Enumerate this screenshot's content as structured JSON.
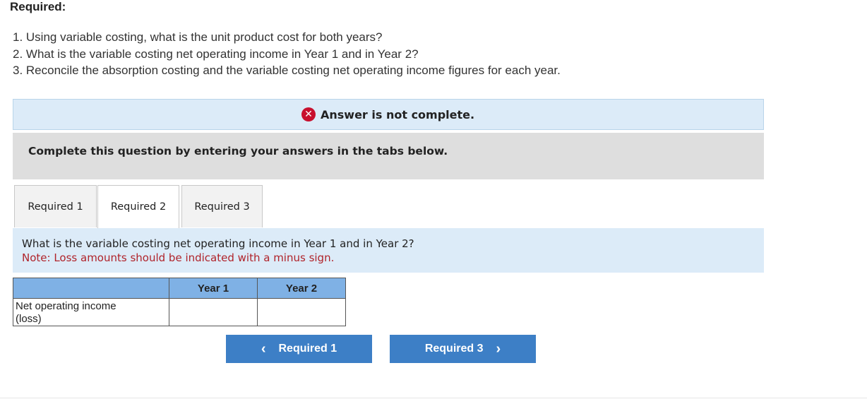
{
  "heading": "Required:",
  "questions": [
    "1. Using variable costing, what is the unit product cost for both years?",
    "2. What is the variable costing net operating income in Year 1 and in Year 2?",
    "3. Reconcile the absorption costing and the variable costing net operating income figures for each year."
  ],
  "answer_status": {
    "icon": "x-circle-icon",
    "text": "Answer is not complete.",
    "icon_color": "#c8102e"
  },
  "instructions": "Complete this question by entering your answers in the tabs below.",
  "tabs": [
    {
      "label": "Required 1",
      "active": false
    },
    {
      "label": "Required 2",
      "active": true
    },
    {
      "label": "Required 3",
      "active": false
    }
  ],
  "prompt": {
    "question": "What is the variable costing net operating income in Year 1 and in Year 2?",
    "note": "Note: Loss amounts should be indicated with a minus sign."
  },
  "table": {
    "headers": [
      "",
      "Year 1",
      "Year 2"
    ],
    "rows": [
      {
        "label_line1": "Net operating income",
        "label_line2": "(loss)",
        "year1_value": "",
        "year2_value": ""
      }
    ],
    "header_color": "#7fb1e5"
  },
  "nav": {
    "prev_label": "Required 1",
    "next_label": "Required 3",
    "button_color": "#3d7fc6"
  }
}
